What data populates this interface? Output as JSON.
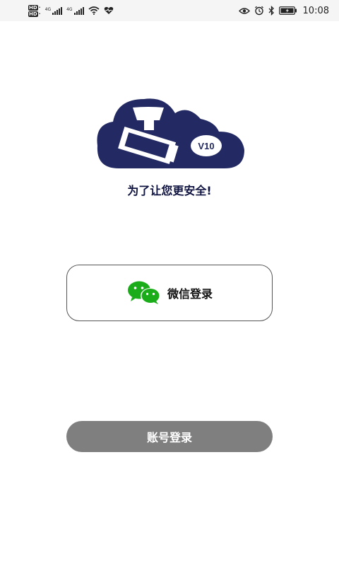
{
  "status_bar": {
    "hd1": "HD",
    "hd2": "HD",
    "net1": "4G",
    "net2": "4G",
    "time": "10:08",
    "icons": [
      "hd-icon",
      "signal-icon",
      "signal-icon",
      "wifi-icon",
      "heart-rate-icon",
      "eye-icon",
      "alarm-icon",
      "bluetooth-icon",
      "battery-icon"
    ]
  },
  "logo": {
    "version": "V10",
    "colors": {
      "cloud": "#232a63",
      "camera": "#ffffff"
    }
  },
  "tagline": "为了让您更安全!",
  "wechat_login": {
    "label": "微信登录",
    "icon": "wechat-icon",
    "icon_color": "#1aad19"
  },
  "account_login": {
    "label": "账号登录",
    "color": "#7f7f7f"
  }
}
